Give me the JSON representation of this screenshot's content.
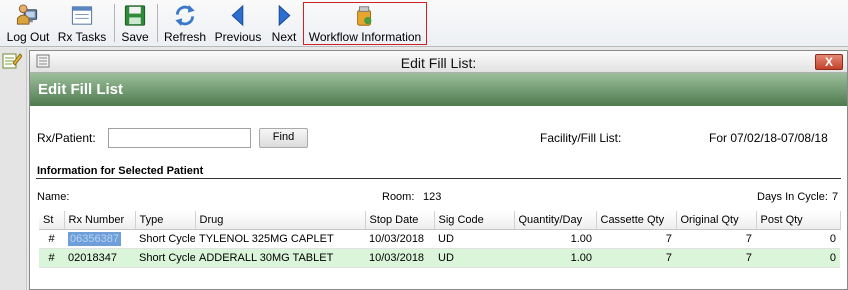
{
  "toolbar": {
    "buttons": [
      {
        "label": "Log Out",
        "icon": "logout-icon"
      },
      {
        "label": "Rx Tasks",
        "icon": "rx-tasks-icon"
      },
      {
        "label": "Save",
        "icon": "save-icon"
      },
      {
        "label": "Refresh",
        "icon": "refresh-icon"
      },
      {
        "label": "Previous",
        "icon": "previous-arrow-icon"
      },
      {
        "label": "Next",
        "icon": "next-arrow-icon"
      },
      {
        "label": "Workflow Information",
        "icon": "workflow-information-icon"
      }
    ],
    "highlight_color": "#cc2222"
  },
  "window": {
    "title": "Edit Fill List:",
    "close_label": "X",
    "banner_title": "Edit Fill List",
    "banner_color": "#4f7b4f"
  },
  "search": {
    "rx_patient_label": "Rx/Patient:",
    "rx_patient_value": "",
    "find_label": "Find",
    "facility_label": "Facility/Fill List:",
    "date_range": "For 07/02/18-07/08/18"
  },
  "patient_info": {
    "section_title": "Information for Selected Patient",
    "name_label": "Name:",
    "name_value": "",
    "room_label": "Room:",
    "room_value": "123",
    "days_label": "Days In Cycle:",
    "days_value": "7"
  },
  "table": {
    "columns": [
      "St",
      "Rx Number",
      "Type",
      "Drug",
      "Stop Date",
      "Sig Code",
      "Quantity/Day",
      "Cassette Qty",
      "Original Qty",
      "Post Qty"
    ],
    "rows": [
      {
        "st": "#",
        "rx_number": "06356387",
        "type": "Short Cycle",
        "drug": "TYLENOL 325MG CAPLET",
        "stop_date": "10/03/2018",
        "sig_code": "UD",
        "quantity_day": "1.00",
        "cassette_qty": "7",
        "original_qty": "7",
        "post_qty": "0"
      },
      {
        "st": "#",
        "rx_number": "02018347",
        "type": "Short Cycle",
        "drug": "ADDERALL 30MG TABLET",
        "stop_date": "10/03/2018",
        "sig_code": "UD",
        "quantity_day": "1.00",
        "cassette_qty": "7",
        "original_qty": "7",
        "post_qty": "0"
      }
    ],
    "highlight_row_color": "#daf5da",
    "selection_color": "#6f9fd8"
  }
}
